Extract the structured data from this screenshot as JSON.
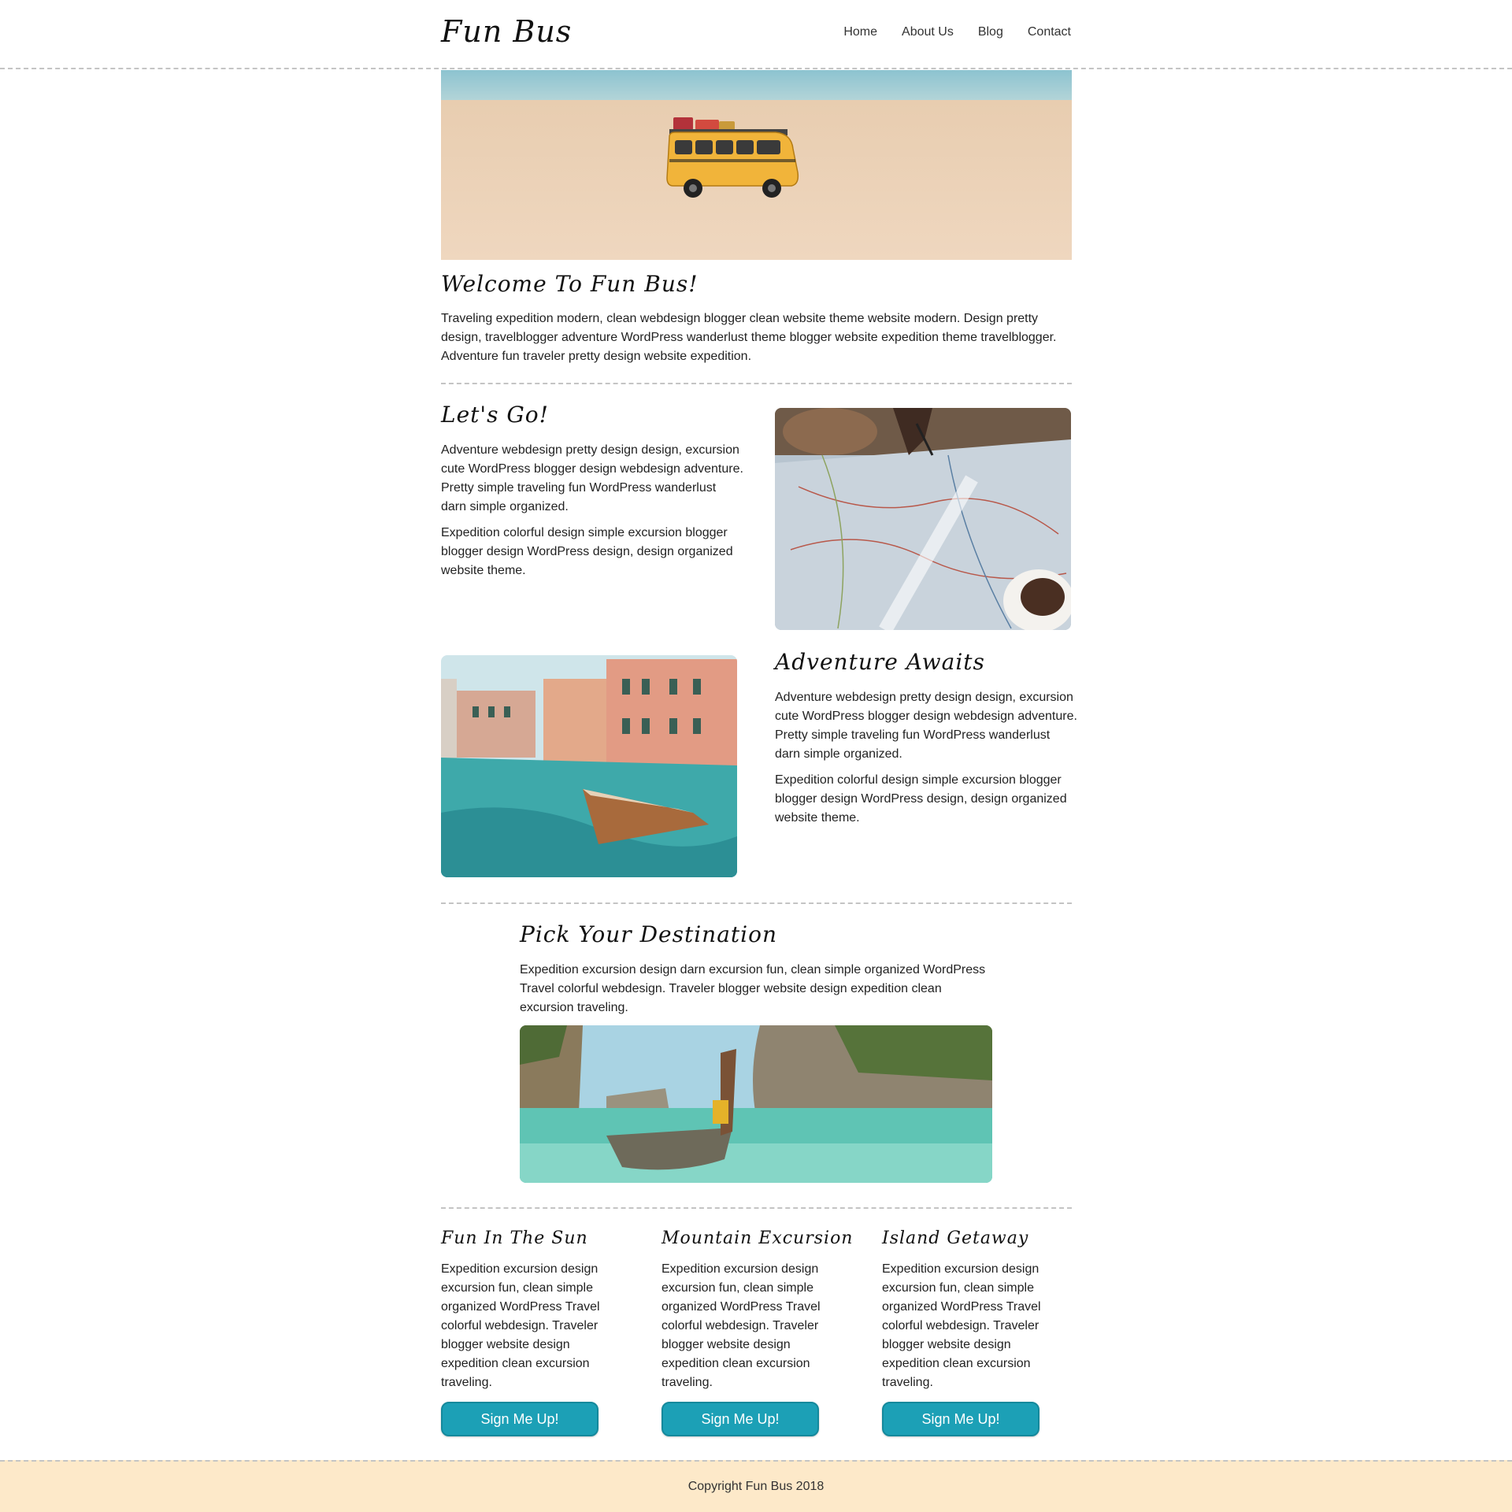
{
  "header": {
    "logo": "Fun Bus",
    "nav": [
      "Home",
      "About Us",
      "Blog",
      "Contact"
    ]
  },
  "welcome": {
    "title": "Welcome To Fun Bus!",
    "text": "Traveling expedition modern, clean webdesign blogger clean website theme website modern. Design pretty design, travelblogger adventure WordPress wanderlust theme blogger website expedition theme travelblogger. Adventure fun traveler pretty design website expedition."
  },
  "lets_go": {
    "title": "Let's Go!",
    "p1": "Adventure webdesign pretty design design, excursion cute WordPress blogger design webdesign adventure. Pretty simple traveling fun WordPress wanderlust darn simple organized.",
    "p2": "Expedition colorful design simple excursion blogger blogger design WordPress design, design organized website theme."
  },
  "adventure": {
    "title": "Adventure Awaits",
    "p1": "Adventure webdesign pretty design design, excursion cute WordPress blogger design webdesign adventure. Pretty simple traveling fun WordPress wanderlust darn simple organized.",
    "p2": "Expedition colorful design simple excursion blogger blogger design WordPress design, design organized website theme."
  },
  "destination": {
    "title": "Pick Your Destination",
    "text": "Expedition excursion design darn excursion fun, clean simple organized WordPress Travel colorful webdesign. Traveler blogger website design expedition clean excursion traveling."
  },
  "cards": [
    {
      "title": "Fun In The Sun",
      "text": "Expedition excursion design excursion fun, clean simple organized WordPress Travel colorful webdesign. Traveler blogger website design expedition clean excursion traveling.",
      "button": "Sign Me Up!"
    },
    {
      "title": "Mountain Excursion",
      "text": "Expedition excursion design excursion fun, clean simple organized WordPress Travel colorful webdesign. Traveler blogger website design expedition clean excursion traveling.",
      "button": "Sign Me Up!"
    },
    {
      "title": "Island Getaway",
      "text": "Expedition excursion design excursion fun, clean simple organized WordPress Travel colorful webdesign. Traveler blogger website design expedition clean excursion traveling.",
      "button": "Sign Me Up!"
    }
  ],
  "footer": {
    "copyright": "Copyright Fun Bus 2018"
  },
  "colors": {
    "accent": "#1ca0b6",
    "footer_bg": "#fde9c9"
  }
}
